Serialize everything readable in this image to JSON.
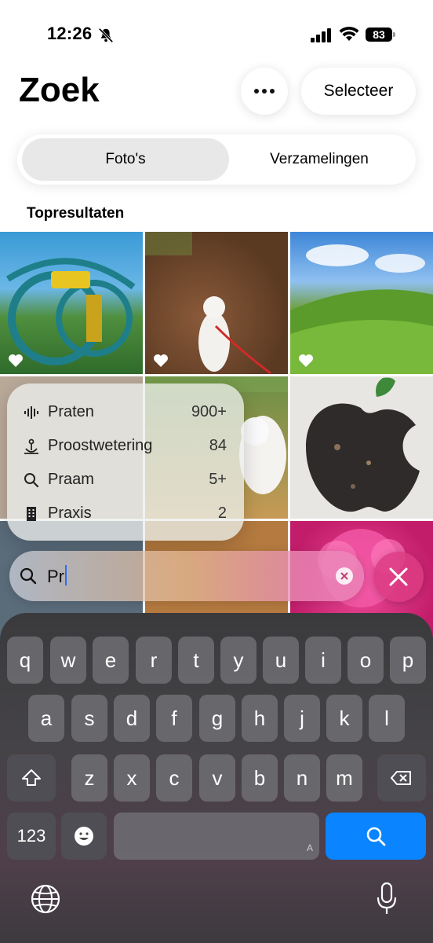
{
  "status_bar": {
    "time": "12:26",
    "battery": "83"
  },
  "header": {
    "title": "Zoek",
    "select_label": "Selecteer"
  },
  "segments": {
    "active": "Foto's",
    "inactive": "Verzamelingen"
  },
  "section_title": "Topresultaten",
  "suggestions": [
    {
      "icon": "waveform-icon",
      "label": "Praten",
      "count": "900+"
    },
    {
      "icon": "drain-icon",
      "label": "Proostwetering",
      "count": "84"
    },
    {
      "icon": "search-icon",
      "label": "Praam",
      "count": "5+"
    },
    {
      "icon": "building-icon",
      "label": "Praxis",
      "count": "2"
    }
  ],
  "search": {
    "value": "Pr"
  },
  "keyboard": {
    "row1": [
      "q",
      "w",
      "e",
      "r",
      "t",
      "y",
      "u",
      "i",
      "o",
      "p"
    ],
    "row2": [
      "a",
      "s",
      "d",
      "f",
      "g",
      "h",
      "j",
      "k",
      "l"
    ],
    "row3": [
      "z",
      "x",
      "c",
      "v",
      "b",
      "n",
      "m"
    ],
    "numbers_label": "123",
    "space_hint": "A"
  },
  "colors": {
    "accent_blue": "#0a84ff",
    "cancel_pink": "#dc3c82"
  }
}
